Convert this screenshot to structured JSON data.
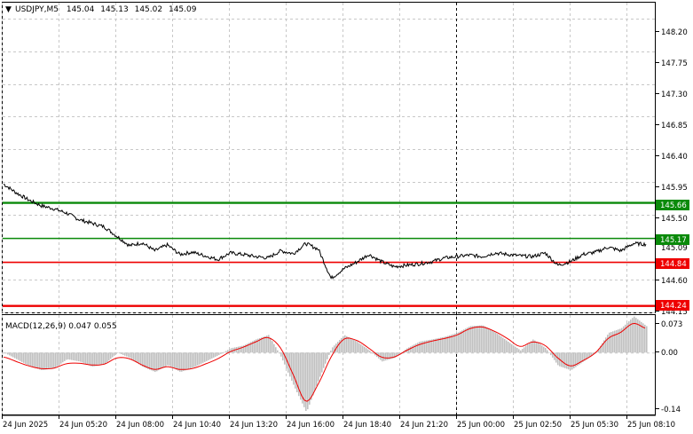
{
  "header": {
    "symbol": "USDJPY,M5",
    "open": "145.04",
    "high": "145.13",
    "low": "145.02",
    "close": "145.09"
  },
  "price_axis": {
    "ticks": [
      "148.20",
      "147.75",
      "147.30",
      "146.85",
      "146.40",
      "145.95",
      "145.50",
      "144.60",
      "144.15"
    ],
    "current_price_label": "145.09"
  },
  "levels": [
    {
      "label": "145.66",
      "color": "#0a8a0a"
    },
    {
      "label": "145.17",
      "color": "#0a8a0a"
    },
    {
      "label": "144.84",
      "color": "#ee0000"
    },
    {
      "label": "144.24",
      "color": "#ee0000"
    }
  ],
  "time_axis": {
    "labels": [
      "24 Jun 2025",
      "24 Jun 05:20",
      "24 Jun 08:00",
      "24 Jun 10:40",
      "24 Jun 13:20",
      "24 Jun 16:00",
      "24 Jun 18:40",
      "24 Jun 21:20",
      "25 Jun 00:00",
      "25 Jun 02:50",
      "25 Jun 05:30",
      "25 Jun 08:10"
    ]
  },
  "macd": {
    "label": "MACD(12,26,9) 0.047 0.055",
    "ticks": [
      "0.073",
      "0.00",
      "-0.14"
    ],
    "histogram_color": "#c0c0c0",
    "signal_color": "#ee0000"
  },
  "chart_data": {
    "type": "line",
    "ylim": [
      144.15,
      148.42
    ],
    "series": [
      {
        "values": [
          145.92,
          145.8,
          145.7,
          145.62,
          145.58,
          145.52,
          145.43,
          145.38,
          145.33,
          145.2,
          145.07,
          145.11,
          145.0,
          145.08,
          144.95,
          144.98,
          144.93,
          144.88,
          144.97,
          144.95,
          144.92,
          144.9,
          145.0,
          144.96,
          145.1,
          145.02,
          144.62,
          144.75,
          144.84,
          144.95,
          144.85,
          144.78,
          144.8,
          144.82,
          144.85,
          144.9,
          144.92,
          144.94,
          144.92,
          144.97,
          144.95,
          144.93,
          144.92,
          144.97,
          144.8,
          144.85,
          144.95,
          144.98,
          145.05,
          145.0,
          145.1,
          145.09
        ]
      }
    ],
    "macd_ylim": [
      -0.14,
      0.085
    ],
    "macd_histogram": [
      0.0,
      -0.015,
      -0.03,
      -0.04,
      -0.035,
      -0.015,
      -0.02,
      -0.032,
      -0.026,
      0.0,
      -0.012,
      -0.032,
      -0.044,
      -0.028,
      -0.044,
      -0.034,
      -0.02,
      -0.006,
      0.01,
      0.016,
      0.03,
      0.04,
      -0.01,
      -0.075,
      -0.135,
      -0.06,
      0.01,
      0.04,
      0.025,
      0.005,
      -0.02,
      -0.012,
      0.01,
      0.025,
      0.03,
      0.036,
      0.045,
      0.06,
      0.062,
      0.046,
      0.025,
      0.005,
      0.03,
      0.01,
      -0.03,
      -0.04,
      -0.02,
      0.0,
      0.045,
      0.055,
      0.082,
      0.06
    ],
    "macd_signal": [
      -0.01,
      -0.02,
      -0.03,
      -0.036,
      -0.035,
      -0.025,
      -0.024,
      -0.028,
      -0.026,
      -0.012,
      -0.014,
      -0.028,
      -0.038,
      -0.032,
      -0.038,
      -0.036,
      -0.026,
      -0.014,
      0.002,
      0.012,
      0.024,
      0.034,
      0.01,
      -0.05,
      -0.11,
      -0.07,
      -0.01,
      0.03,
      0.028,
      0.01,
      -0.01,
      -0.01,
      0.005,
      0.018,
      0.026,
      0.032,
      0.04,
      0.054,
      0.058,
      0.048,
      0.032,
      0.014,
      0.024,
      0.016,
      -0.012,
      -0.03,
      -0.018,
      0.0,
      0.032,
      0.046,
      0.066,
      0.055
    ]
  }
}
